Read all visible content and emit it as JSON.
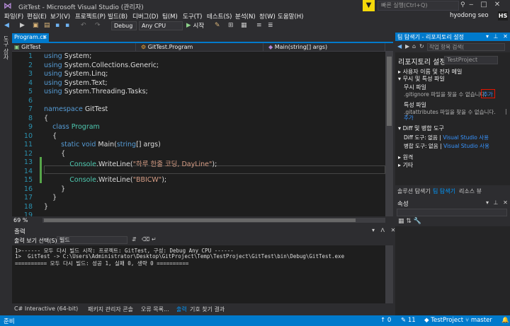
{
  "window": {
    "title": "GitTest - Microsoft Visual Studio (관리자)",
    "quick_launch_placeholder": "빠른 실행(Ctrl+Q)",
    "user_name": "hyodong seo",
    "user_initials": "HS"
  },
  "menu": [
    "파일(F)",
    "편집(E)",
    "보기(V)",
    "프로젝트(P)",
    "빌드(B)",
    "디버그(D)",
    "팀(M)",
    "도구(T)",
    "테스트(S)",
    "분석(N)",
    "창(W)",
    "도움말(H)"
  ],
  "toolbar": {
    "config": "Debug",
    "platform": "Any CPU",
    "start_label": "시작"
  },
  "left_tab": "도구 상자",
  "editor": {
    "tab_label": "Program.cs",
    "nav_project": "GitTest",
    "nav_class": "GitTest.Program",
    "nav_member": "Main(string[] args)",
    "zoom": "69 %",
    "line_numbers": [
      "1",
      "2",
      "3",
      "4",
      "5",
      "6",
      "7",
      "8",
      "9",
      "10",
      "11",
      "12",
      "13",
      "14",
      "15",
      "16",
      "17",
      "18",
      "19"
    ],
    "lines": [
      {
        "indent": "",
        "parts": [
          {
            "t": "using",
            "c": "kw"
          },
          {
            "t": " System;",
            "c": ""
          }
        ]
      },
      {
        "indent": "",
        "parts": [
          {
            "t": "using",
            "c": "kw"
          },
          {
            "t": " System.Collections.Generic;",
            "c": ""
          }
        ]
      },
      {
        "indent": "",
        "parts": [
          {
            "t": "using",
            "c": "kw"
          },
          {
            "t": " System.Linq;",
            "c": ""
          }
        ]
      },
      {
        "indent": "",
        "parts": [
          {
            "t": "using",
            "c": "kw"
          },
          {
            "t": " System.Text;",
            "c": ""
          }
        ]
      },
      {
        "indent": "",
        "parts": [
          {
            "t": "using",
            "c": "kw"
          },
          {
            "t": " System.Threading.Tasks;",
            "c": ""
          }
        ]
      },
      {
        "indent": "",
        "parts": []
      },
      {
        "indent": "",
        "parts": [
          {
            "t": "namespace",
            "c": "kw"
          },
          {
            "t": " GitTest",
            "c": ""
          }
        ]
      },
      {
        "indent": "",
        "parts": [
          {
            "t": "{",
            "c": ""
          }
        ]
      },
      {
        "indent": "    ",
        "parts": [
          {
            "t": "class",
            "c": "kw"
          },
          {
            "t": " ",
            "c": ""
          },
          {
            "t": "Program",
            "c": "ty"
          }
        ]
      },
      {
        "indent": "    ",
        "parts": [
          {
            "t": "{",
            "c": ""
          }
        ]
      },
      {
        "indent": "        ",
        "parts": [
          {
            "t": "static",
            "c": "kw"
          },
          {
            "t": " ",
            "c": ""
          },
          {
            "t": "void",
            "c": "kw"
          },
          {
            "t": " Main(",
            "c": ""
          },
          {
            "t": "string",
            "c": "kw"
          },
          {
            "t": "[] args)",
            "c": ""
          }
        ]
      },
      {
        "indent": "        ",
        "parts": [
          {
            "t": "{",
            "c": ""
          }
        ]
      },
      {
        "indent": "            ",
        "parts": [
          {
            "t": "Console",
            "c": "ty"
          },
          {
            "t": ".WriteLine(",
            "c": ""
          },
          {
            "t": "\"하루 한줄 코딩, DayLine\"",
            "c": "str"
          },
          {
            "t": ");",
            "c": ""
          }
        ]
      },
      {
        "indent": "",
        "parts": []
      },
      {
        "indent": "            ",
        "parts": [
          {
            "t": "Console",
            "c": "ty"
          },
          {
            "t": ".WriteLine(",
            "c": ""
          },
          {
            "t": "\"BBICW\"",
            "c": "str"
          },
          {
            "t": ");",
            "c": ""
          }
        ]
      },
      {
        "indent": "        ",
        "parts": [
          {
            "t": "}",
            "c": ""
          }
        ]
      },
      {
        "indent": "    ",
        "parts": [
          {
            "t": "}",
            "c": ""
          }
        ]
      },
      {
        "indent": "",
        "parts": [
          {
            "t": "}",
            "c": ""
          }
        ]
      },
      {
        "indent": "",
        "parts": []
      }
    ]
  },
  "output": {
    "title": "출력",
    "source_label": "출력 보기 선택(S):",
    "source_value": "빌드",
    "lines": [
      "1>------ 모두 다시 빌드 시작: 프로젝트: GitTest, 구성: Debug Any CPU ------",
      "1>  GitTest -> C:\\Users\\Administrator\\Desktop\\GitProject\\Temp\\TestProject\\GitTest\\bin\\Debug\\GitTest.exe",
      "========== 모두 다시 빌드: 성공 1, 실패 0, 생략 0 =========="
    ]
  },
  "bottom_tabs": [
    "C# Interactive (64-bit)",
    "패키지 관리자 콘솔",
    "오류 목록...",
    "출력",
    "기호 찾기 결과"
  ],
  "right_panel": {
    "title": "팀 탐색기 - 리포지토리 설정",
    "search_placeholder": "작업 항목 검색(",
    "heading": "리포지토리 설정",
    "project": "TestProject",
    "sec_user": "사용자 이름 및 전자 메일",
    "sec_ignore": "무시 및 특성 파일",
    "ignore_file_label": "무시 파일",
    "ignore_note": ".gitignore 파일을 찾을 수 없습니다.",
    "add_label": "추가",
    "attr_file_label": "특성 파일",
    "attr_note": ".gitattributes 파일을 찾을 수 없습니다.",
    "attr_sep": "|",
    "sec_diff": "Diff 및 병합 도구",
    "diff_label": "Diff 도구: 없음",
    "diff_link": "Visual Studio 사용",
    "merge_label": "병합 도구: 없음",
    "merge_link": "Visual Studio 사용",
    "sec_remote": "원격",
    "sec_other": "기타",
    "tabs": [
      "솔루션 탐색기",
      "팀 탐색기",
      "리소스 뷰"
    ]
  },
  "properties": {
    "title": "속성"
  },
  "status": {
    "ready": "준비",
    "up_count": "0",
    "edit_count": "11",
    "project": "TestProject",
    "branch": "master"
  }
}
